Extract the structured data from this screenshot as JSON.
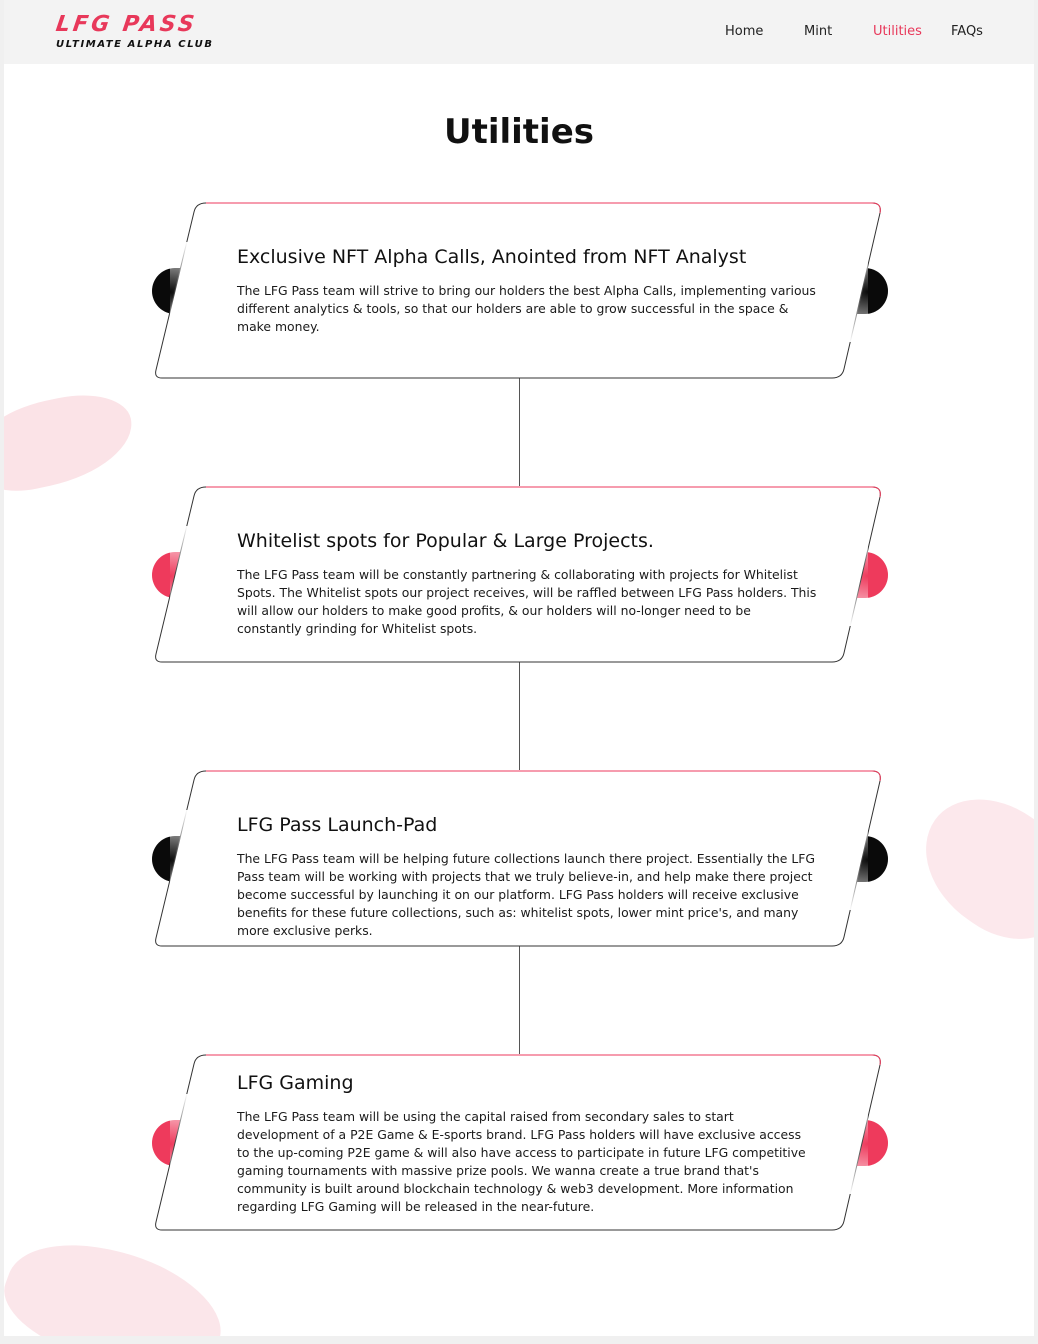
{
  "header": {
    "logo_main": "LFG PASS",
    "logo_sub": "ULTIMATE ALPHA CLUB",
    "nav": [
      {
        "label": "Home",
        "active": false
      },
      {
        "label": "Mint",
        "active": false
      },
      {
        "label": "Utilities",
        "active": true
      },
      {
        "label": "FAQs",
        "active": false
      }
    ]
  },
  "main": {
    "title": "Utilities",
    "cards": [
      {
        "title": "Exclusive NFT Alpha Calls, Anointed from NFT Analyst",
        "text": "The LFG Pass team will strive to bring our holders the best Alpha Calls, implementing various different analytics & tools, so that our holders are able to grow successful in the space & make money.",
        "dot_color": "black"
      },
      {
        "title": "Whitelist spots for Popular & Large Projects.",
        "text": "The LFG Pass team will be constantly partnering & collaborating with projects for Whitelist Spots. The Whitelist spots our project receives, will be raffled between LFG Pass holders. This will allow our holders to make good profits, & our holders will no-longer need to be constantly grinding for Whitelist spots.",
        "dot_color": "pink"
      },
      {
        "title": "LFG Pass Launch-Pad",
        "text": "The LFG Pass team will be helping future collections launch there project. Essentially the LFG Pass team will be working with projects that we truly believe-in, and help make there project become successful by launching it on our platform.  LFG Pass holders will receive exclusive benefits for these future collections, such as: whitelist spots, lower mint price's, and many more exclusive perks.",
        "dot_color": "black"
      },
      {
        "title": "LFG Gaming",
        "text": "The LFG Pass team will be using the capital raised from secondary sales to start development of a P2E Game & E-sports brand. LFG Pass holders will have exclusive access to the up-coming P2E game & will also have access to participate in future LFG competitive gaming tournaments with massive prize pools. We wanna create a true brand that's community is built around blockchain technology & web3 development. More information regarding LFG Gaming will be released in the near-future.",
        "dot_color": "pink"
      }
    ]
  },
  "colors": {
    "accent": "#e8385a",
    "dot_pink": "#ee3a5c",
    "dot_black": "#0a0a0a",
    "blob": "#fbe3e7"
  }
}
